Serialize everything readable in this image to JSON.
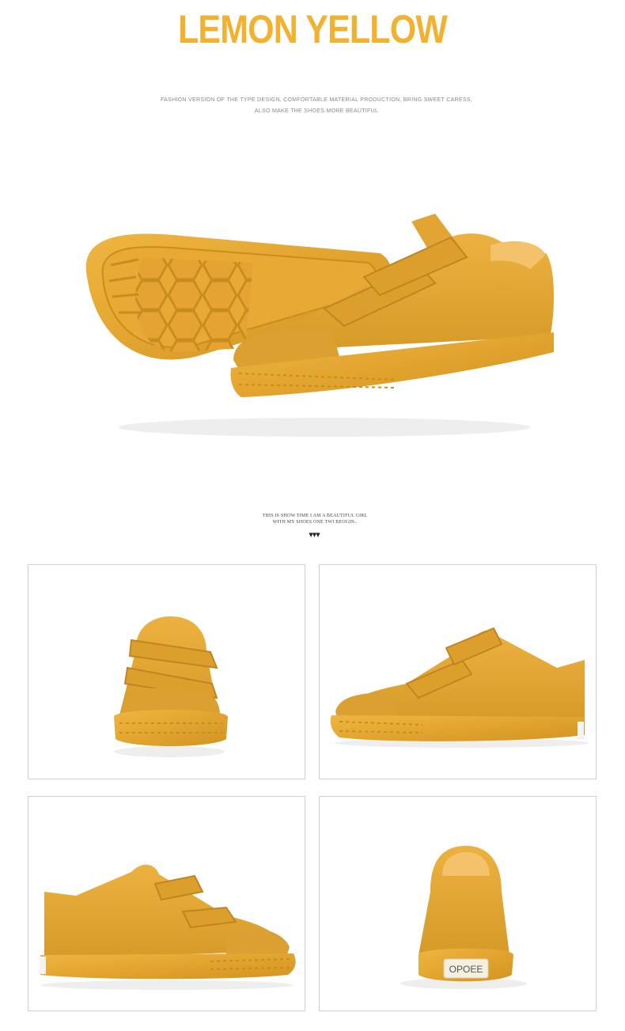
{
  "header": {
    "title": "LEMON YELLOW",
    "subtitle_line1": "FASHION VERSION OF THE TYPE DESIGN, COMFORTABLE MATERIAL PRODUCTION, BRING SWEET CARESS,",
    "subtitle_line2": "ALSO MAKE THE SHOES MORE BEAUTIFUL"
  },
  "caption": {
    "line1": "THIS IS SHOW TIME I AM A BEAUTIFUL GIRL",
    "line2": "WITH MY SHOES ONE TWI BEOGIN..",
    "arrows": "▼▼▼"
  },
  "gallery": {
    "panels": [
      {
        "view": "front-view"
      },
      {
        "view": "side-view-right"
      },
      {
        "view": "side-view-left"
      },
      {
        "view": "back-view",
        "heel_label": "OPOEE"
      }
    ]
  },
  "colors": {
    "accent": "#f2b230",
    "shoe_body": "#e3a734",
    "shoe_sole": "#d99a25",
    "shoe_shadow": "#c48a22",
    "panel_border": "#cfcfcf"
  }
}
